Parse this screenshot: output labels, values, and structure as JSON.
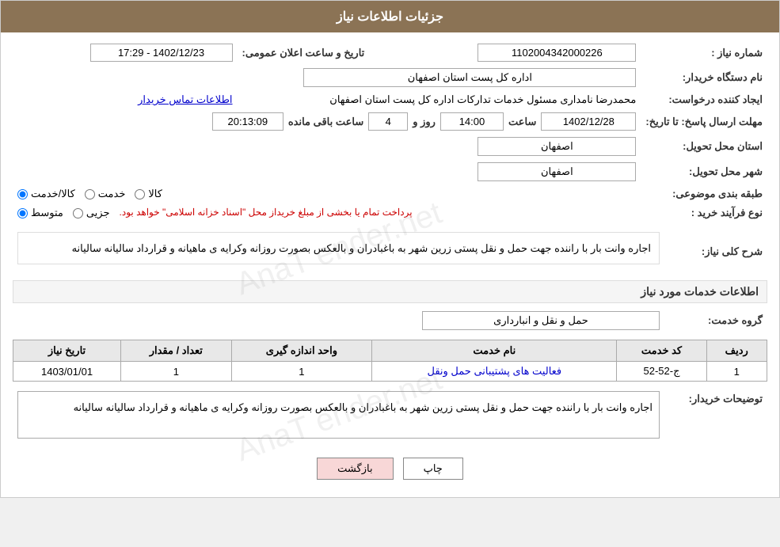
{
  "header": {
    "title": "جزئیات اطلاعات نیاز"
  },
  "fields": {
    "need_number_label": "شماره نیاز :",
    "need_number_value": "1102004342000226",
    "org_name_label": "نام دستگاه خریدار:",
    "org_name_value": "اداره کل پست استان اصفهان",
    "announce_date_label": "تاریخ و ساعت اعلان عمومی:",
    "announce_date_value": "1402/12/23 - 17:29",
    "creator_label": "ایجاد کننده درخواست:",
    "creator_value": "محمدرضا نامداری مسئول خدمات تداركات اداره كل پست استان اصفهان",
    "contact_link": "اطلاعات تماس خریدار",
    "deadline_label": "مهلت ارسال پاسخ: تا تاریخ:",
    "deadline_date": "1402/12/28",
    "deadline_time_label": "ساعت",
    "deadline_time": "14:00",
    "deadline_days_label": "روز و",
    "deadline_days": "4",
    "deadline_remaining_label": "ساعت باقی مانده",
    "deadline_remaining": "20:13:09",
    "delivery_province_label": "استان محل تحویل:",
    "delivery_province_value": "اصفهان",
    "delivery_city_label": "شهر محل تحویل:",
    "delivery_city_value": "اصفهان",
    "category_label": "طبقه بندی موضوعی:",
    "category_options": [
      "کالا",
      "خدمت",
      "کالا/خدمت"
    ],
    "category_selected": "کالا/خدمت",
    "process_label": "نوع فرآیند خرید :",
    "process_options": [
      "جزیی",
      "متوسط"
    ],
    "process_note": "پرداخت تمام یا بخشی از مبلغ خریداز محل \"اسناد خزانه اسلامی\" خواهد بود.",
    "process_selected": "متوسط"
  },
  "description": {
    "section_title": "شرح کلی نیاز:",
    "text": "اجاره وانت بار با راننده جهت حمل و نقل پستی زرین شهر  به باغبادران و بالعکس بصورت روزانه وکرایه ی ماهیانه و قرارداد سالیانه سالیانه"
  },
  "services_section": {
    "title": "اطلاعات خدمات مورد نیاز",
    "service_group_label": "گروه خدمت:",
    "service_group_value": "حمل و نقل و انبارداری",
    "table": {
      "headers": [
        "ردیف",
        "کد خدمت",
        "نام خدمت",
        "واحد اندازه گیری",
        "تعداد / مقدار",
        "تاریخ نیاز"
      ],
      "rows": [
        {
          "row": "1",
          "code": "ج-52-52",
          "name": "فعالیت های پشتیبانی حمل ونقل",
          "unit": "1",
          "quantity": "1",
          "date": "1403/01/01"
        }
      ]
    }
  },
  "buyer_description": {
    "label": "توضیحات خریدار:",
    "text": "اجاره وانت بار با راننده جهت حمل و نقل پستی زرین شهر  به باغبادران و بالعکس بصورت روزانه وکرایه ی ماهیانه و قرارداد سالیانه سالیانه"
  },
  "buttons": {
    "print": "چاپ",
    "back": "بازگشت"
  }
}
